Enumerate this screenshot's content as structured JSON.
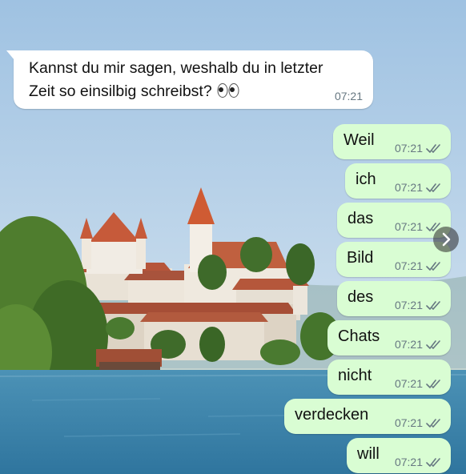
{
  "chat": {
    "incoming": {
      "text": "Kannst du mir sagen, weshalb du in letzter\nZeit so einsilbig schreibst?",
      "emoji": "eyes-emoji",
      "time": "07:21"
    },
    "outgoing": [
      {
        "text": "Weil",
        "time": "07:21",
        "status": "read"
      },
      {
        "text": "ich",
        "time": "07:21",
        "status": "read"
      },
      {
        "text": "das",
        "time": "07:21",
        "status": "read"
      },
      {
        "text": "Bild",
        "time": "07:21",
        "status": "read"
      },
      {
        "text": "des",
        "time": "07:21",
        "status": "read"
      },
      {
        "text": "Chats",
        "time": "07:21",
        "status": "read"
      },
      {
        "text": "nicht",
        "time": "07:21",
        "status": "read"
      },
      {
        "text": "verdecken",
        "time": "07:21",
        "status": "read"
      },
      {
        "text": "will",
        "time": "07:21",
        "status": "read"
      }
    ]
  },
  "icons": {
    "forward": "chevron-right-icon",
    "ticks": "double-check-icon"
  },
  "colors": {
    "sky": "#a9c9e6",
    "water": "#3f86ad",
    "outgoing_bubble": "#d9fdd3",
    "incoming_bubble": "#ffffff"
  }
}
